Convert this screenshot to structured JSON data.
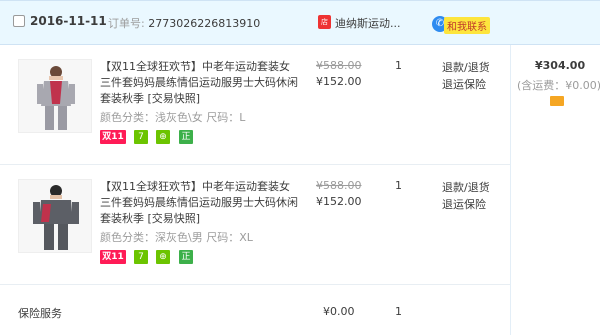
{
  "order": {
    "date": "2016-11-11",
    "order_no_label": "订单号:",
    "order_no": "2773026226813910",
    "shop_name": "迪纳斯运动...",
    "contact_label": "和我联系",
    "total": "¥304.00",
    "shipping_note": "(含运费：¥0.00)"
  },
  "items": [
    {
      "title": "【双11全球狂欢节】中老年运动套装女三件套妈妈晨练情侣运动服男士大码休闲套装秋季 [交易快照]",
      "sku": "颜色分类：浅灰色\\女  尺码：L",
      "old_price": "¥588.00",
      "price": "¥152.00",
      "qty": "1",
      "action_refund": "退款/退货",
      "action_insurance": "退运保险",
      "tag_double11": "双11",
      "tag_7": "7",
      "tag_tb": "⊕",
      "tag_genuine": "正"
    },
    {
      "title": "【双11全球狂欢节】中老年运动套装女三件套妈妈晨练情侣运动服男士大码休闲套装秋季 [交易快照]",
      "sku": "颜色分类：深灰色\\男  尺码：XL",
      "old_price": "¥588.00",
      "price": "¥152.00",
      "qty": "1",
      "action_refund": "退款/退货",
      "action_insurance": "退运保险",
      "tag_double11": "双11",
      "tag_7": "7",
      "tag_tb": "⊕",
      "tag_genuine": "正"
    }
  ],
  "insurance": {
    "label": "保险服务",
    "price": "¥0.00",
    "qty": "1"
  },
  "colors": {
    "header_bg": "#eaf8ff",
    "double11_tag": "#ff1b56",
    "green_tag": "#6cc400",
    "contact_bg": "#fde53d"
  }
}
